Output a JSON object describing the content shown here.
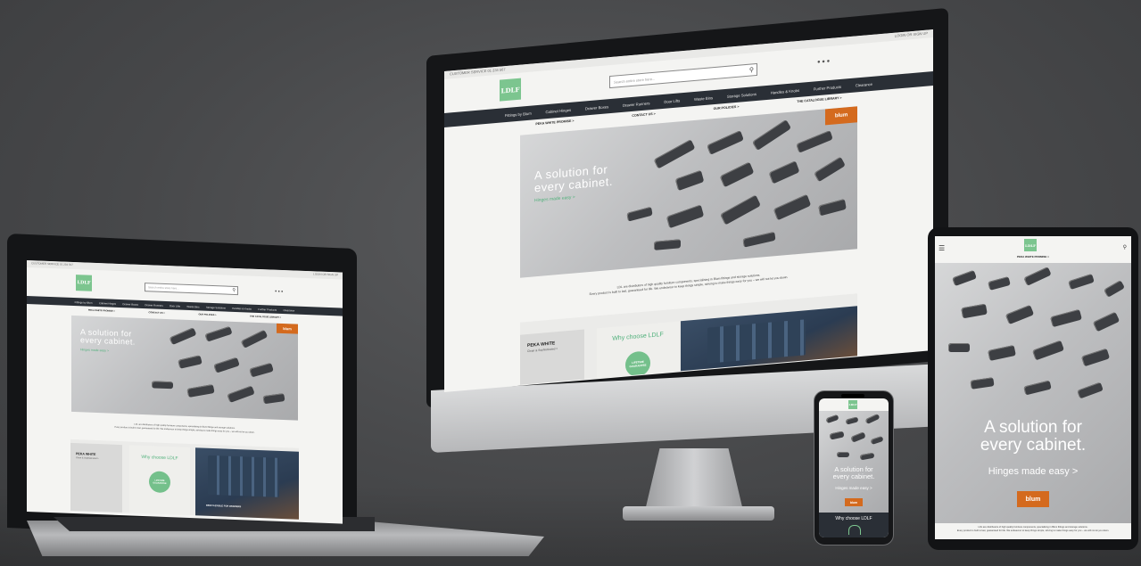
{
  "site": {
    "topbar_left": "CUSTOMER SERVICE 01 234 567",
    "account_links": "LOGIN OR SIGN UP",
    "logo_text": "LDLF",
    "search_placeholder": "Search entire store here...",
    "nav": [
      "Fittings by Blum",
      "Cabinet Hinges",
      "Drawer Boxes",
      "Drawer Runners",
      "Door Lifts",
      "Waste Bins",
      "Storage Solutions",
      "Handles & Knobs",
      "Further Products",
      "Clearance"
    ],
    "sub_links": [
      "PEKA WHITE PROMISE >",
      "CONTACT US >",
      "OUR POLICIES >",
      "THE CATALOGUE LIBRARY >"
    ],
    "hero_line1": "A solution for",
    "hero_line2": "every cabinet.",
    "hero_link": "Hinges made easy >",
    "hero_link_short": "Hinges made easy >",
    "blum_badge": "blum",
    "intro_line1": "LDL are distributors of high quality furniture components, specialising in Blum fittings and storage solutions.",
    "intro_line2": "Every product is built to last, guaranteed for life. We endeavour to keep things simple, striving to make things easy for you – we will not let you down.",
    "card1_title": "PEKA WHITE",
    "card1_sub": "Clean & Sophisticated >",
    "card2_title": "Why choose LDLF",
    "stamp_text": "LIFETIME GUARANTEE",
    "card3_caption": "BEM FLEXIBLE FOR DRAWERS",
    "tablet_hero_line1": "A solution for",
    "tablet_hero_line2": "every cabinet.",
    "tablet_hero_link": "Hinges made easy >",
    "tablet_blum": "blum",
    "phone_hero_line1": "A solution for",
    "phone_hero_line2": "every cabinet.",
    "phone_hero_link": "Hinges made easy >",
    "phone_why": "Why choose LDLF"
  },
  "colors": {
    "brand_green": "#7cc58f",
    "nav_dark": "#2a2f36",
    "blum_orange": "#d46a1e",
    "hero_link_green": "#4fb07a",
    "background_grey": "#4a4b4d"
  },
  "icons": [
    "search-icon",
    "user-icon",
    "social-icon",
    "hamburger-icon",
    "apple-logo-icon"
  ]
}
